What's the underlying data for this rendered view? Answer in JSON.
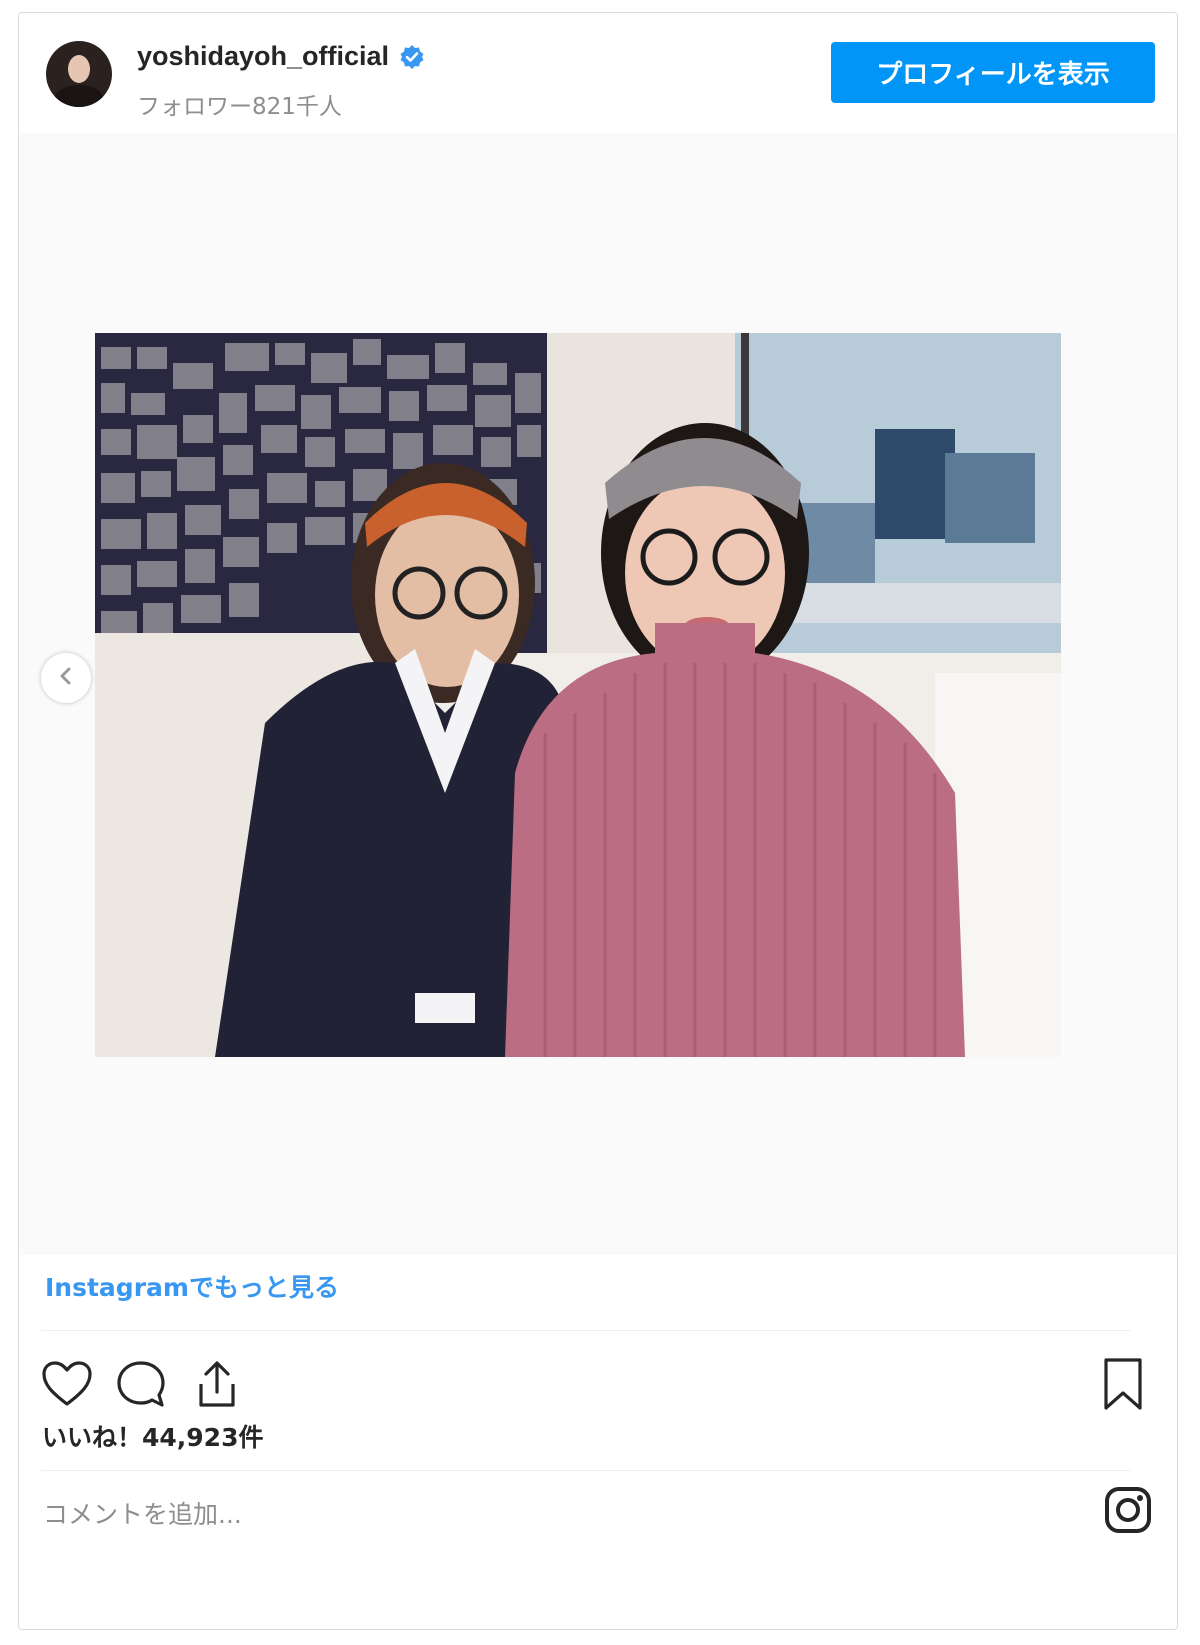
{
  "header": {
    "username": "yoshidayoh_official",
    "followers": "フォロワー821千人",
    "profile_button": "プロフィールを表示",
    "verified_icon": "verified-badge-icon",
    "avatar_icon": "profile-avatar"
  },
  "media": {
    "photo_description_icon": "post-photo",
    "prev_icon": "chevron-left-icon"
  },
  "more_link": "Instagramでもっと見る",
  "actions": {
    "like_icon": "heart-icon",
    "comment_icon": "comment-icon",
    "share_icon": "share-icon",
    "save_icon": "bookmark-icon"
  },
  "likes": "いいね！44,923件",
  "comment": {
    "placeholder": "コメントを追加..."
  },
  "footer": {
    "logo_icon": "instagram-icon"
  },
  "colors": {
    "accent": "#0095f6",
    "link": "#3897f0",
    "text": "#262626",
    "muted": "#8e8e8e",
    "border": "#dbdbdb"
  }
}
